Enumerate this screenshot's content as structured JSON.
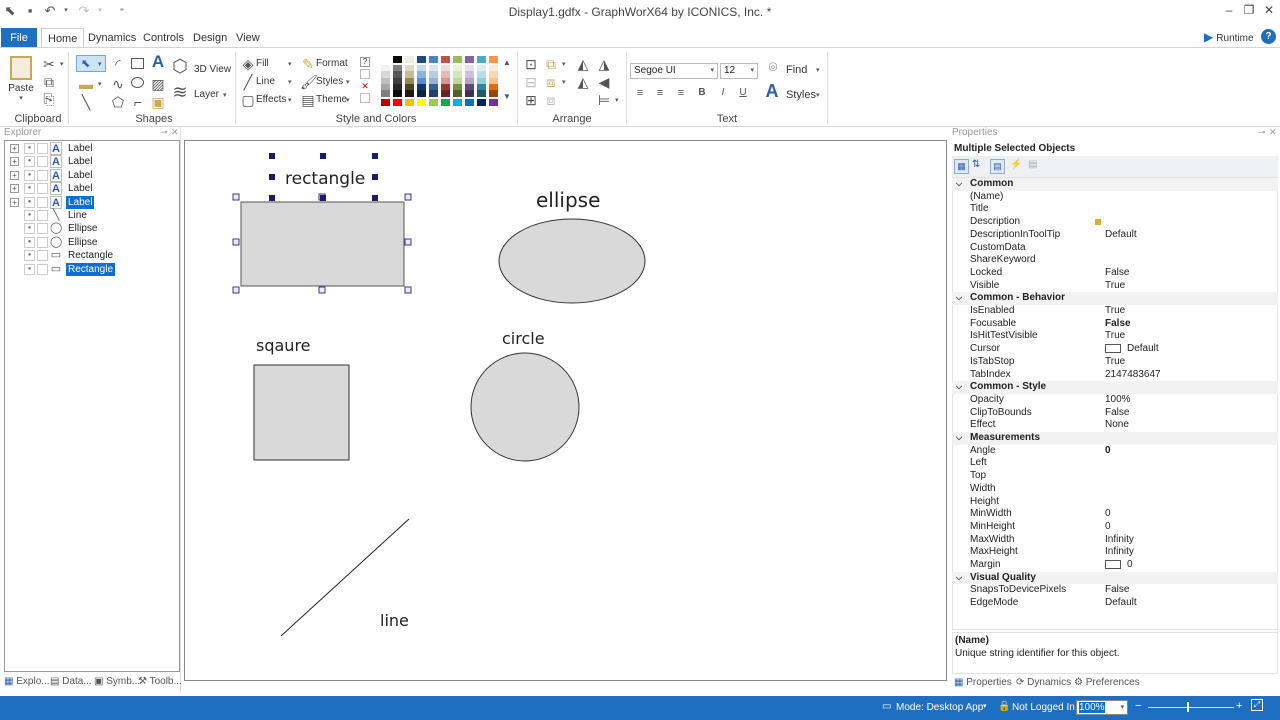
{
  "window": {
    "title": "Display1.gdfx - GraphWorX64 by ICONICS, Inc. *",
    "minimize": "–",
    "restore": "❐",
    "close": "✕"
  },
  "menu": {
    "file": "File",
    "tabs": [
      "Home",
      "Dynamics",
      "Controls",
      "Design",
      "View"
    ],
    "runtime": "Runtime"
  },
  "ribbon": {
    "clipboard": {
      "paste": "Paste",
      "group": "Clipboard"
    },
    "shapes": {
      "view3d": "3D View",
      "layer": "Layer",
      "group": "Shapes"
    },
    "style": {
      "fill": "Fill",
      "line": "Line",
      "effects": "Effects",
      "format": "Format",
      "styles": "Styles",
      "theme": "Theme",
      "group": "Style and Colors"
    },
    "arrange": {
      "group": "Arrange"
    },
    "text": {
      "font": "Segoe UI",
      "size": "12",
      "find": "Find",
      "styles": "Styles",
      "group": "Text",
      "bold": "B",
      "italic": "I",
      "underline": "U"
    },
    "palette_columns": [
      [
        "#ffffff",
        "#f2f2f2",
        "#d9d9d9",
        "#bfbfbf",
        "#a6a6a6",
        "#808080"
      ],
      [
        "#000000",
        "#7f7f7f",
        "#595959",
        "#404040",
        "#262626",
        "#0d0d0d"
      ],
      [
        "#eeece1",
        "#ddd9c4",
        "#c4bd97",
        "#948a54",
        "#4a452a",
        "#1e1c11"
      ],
      [
        "#1f497d",
        "#c6d9f1",
        "#8db3e2",
        "#548dd4",
        "#17365d",
        "#0f243e"
      ],
      [
        "#4f81bd",
        "#dbe5f1",
        "#b8cce4",
        "#95b3d7",
        "#366092",
        "#244062"
      ],
      [
        "#c0504d",
        "#f2dcdb",
        "#e6b9b8",
        "#d99694",
        "#953735",
        "#632523"
      ],
      [
        "#9bbb59",
        "#ebf1de",
        "#d7e4bd",
        "#c3d69b",
        "#76923c",
        "#4f6228"
      ],
      [
        "#8064a2",
        "#e5e0ec",
        "#ccc1da",
        "#b3a2c7",
        "#5f497a",
        "#3f3151"
      ],
      [
        "#4bacc6",
        "#dbeef4",
        "#b7dee8",
        "#93cddd",
        "#31859c",
        "#215968"
      ],
      [
        "#f79646",
        "#fdeada",
        "#fbd5b5",
        "#fac090",
        "#e46c0a",
        "#984807"
      ]
    ],
    "palette_standard": [
      "#c00000",
      "#ff0000",
      "#ffc000",
      "#ffff00",
      "#92d050",
      "#00b050",
      "#00b0f0",
      "#0070c0",
      "#002060",
      "#7030a0"
    ]
  },
  "explorer": {
    "title": "Explorer",
    "items": [
      {
        "label": "Label",
        "icon": "text-A-icon",
        "expandable": true,
        "selected": false
      },
      {
        "label": "Label",
        "icon": "text-A-icon",
        "expandable": true,
        "selected": false
      },
      {
        "label": "Label",
        "icon": "text-A-icon",
        "expandable": true,
        "selected": false
      },
      {
        "label": "Label",
        "icon": "text-A-icon",
        "expandable": true,
        "selected": false
      },
      {
        "label": "Label",
        "icon": "text-A-icon",
        "expandable": true,
        "selected": true
      },
      {
        "label": "Line",
        "icon": "line-icon",
        "expandable": false,
        "selected": false
      },
      {
        "label": "Ellipse",
        "icon": "ellipse-icon",
        "expandable": false,
        "selected": false
      },
      {
        "label": "Ellipse",
        "icon": "ellipse-icon",
        "expandable": false,
        "selected": false
      },
      {
        "label": "Rectangle",
        "icon": "rectangle-icon",
        "expandable": false,
        "selected": false
      },
      {
        "label": "Rectangle",
        "icon": "rectangle-icon",
        "expandable": false,
        "selected": true
      }
    ],
    "bottom_tabs": [
      "Explo...",
      "Data...",
      "Symb...",
      "Toolb..."
    ]
  },
  "canvas": {
    "labels": {
      "rectangle": "rectangle",
      "ellipse": "ellipse",
      "square": "sqaure",
      "circle": "circle",
      "line": "line"
    },
    "shape_fill": "#d9d9d9",
    "handle_color": "#1a1a6e"
  },
  "properties": {
    "title": "Properties",
    "header": "Multiple Selected Objects",
    "rows": [
      {
        "type": "cat",
        "key": "Common"
      },
      {
        "key": "(Name)",
        "value": ""
      },
      {
        "key": "Title",
        "value": ""
      },
      {
        "key": "Description",
        "value": ""
      },
      {
        "key": "DescriptionInToolTip",
        "value": "Default"
      },
      {
        "key": "CustomData",
        "value": ""
      },
      {
        "key": "ShareKeyword",
        "value": ""
      },
      {
        "key": "Locked",
        "value": "False"
      },
      {
        "key": "Visible",
        "value": "True"
      },
      {
        "type": "cat",
        "key": "Common - Behavior"
      },
      {
        "key": "IsEnabled",
        "value": "True"
      },
      {
        "key": "Focusable",
        "value": "False",
        "bold": true
      },
      {
        "key": "IsHitTestVisible",
        "value": "True"
      },
      {
        "key": "Cursor",
        "value": "Default",
        "box": true
      },
      {
        "key": "IsTabStop",
        "value": "True"
      },
      {
        "key": "TabIndex",
        "value": "2147483647"
      },
      {
        "type": "cat",
        "key": "Common - Style"
      },
      {
        "key": "Opacity",
        "value": "100%"
      },
      {
        "key": "ClipToBounds",
        "value": "False"
      },
      {
        "key": "Effect",
        "value": "None"
      },
      {
        "type": "cat",
        "key": "Measurements"
      },
      {
        "key": "Angle",
        "value": "0",
        "bold": true
      },
      {
        "key": "Left",
        "value": ""
      },
      {
        "key": "Top",
        "value": ""
      },
      {
        "key": "Width",
        "value": ""
      },
      {
        "key": "Height",
        "value": ""
      },
      {
        "key": "MinWidth",
        "value": "0"
      },
      {
        "key": "MinHeight",
        "value": "0"
      },
      {
        "key": "MaxWidth",
        "value": "Infinity"
      },
      {
        "key": "MaxHeight",
        "value": "Infinity"
      },
      {
        "key": "Margin",
        "value": "0",
        "box": true
      },
      {
        "type": "cat",
        "key": "Visual Quality"
      },
      {
        "key": "SnapsToDevicePixels",
        "value": "False"
      },
      {
        "key": "EdgeMode",
        "value": "Default"
      }
    ],
    "help_title": "(Name)",
    "help_text": "Unique string identifier for this object.",
    "bottom_tabs": [
      "Properties",
      "Dynamics",
      "Preferences"
    ]
  },
  "status": {
    "mode": "Mode: Desktop App",
    "login": "Not Logged In",
    "zoom": "100%"
  }
}
